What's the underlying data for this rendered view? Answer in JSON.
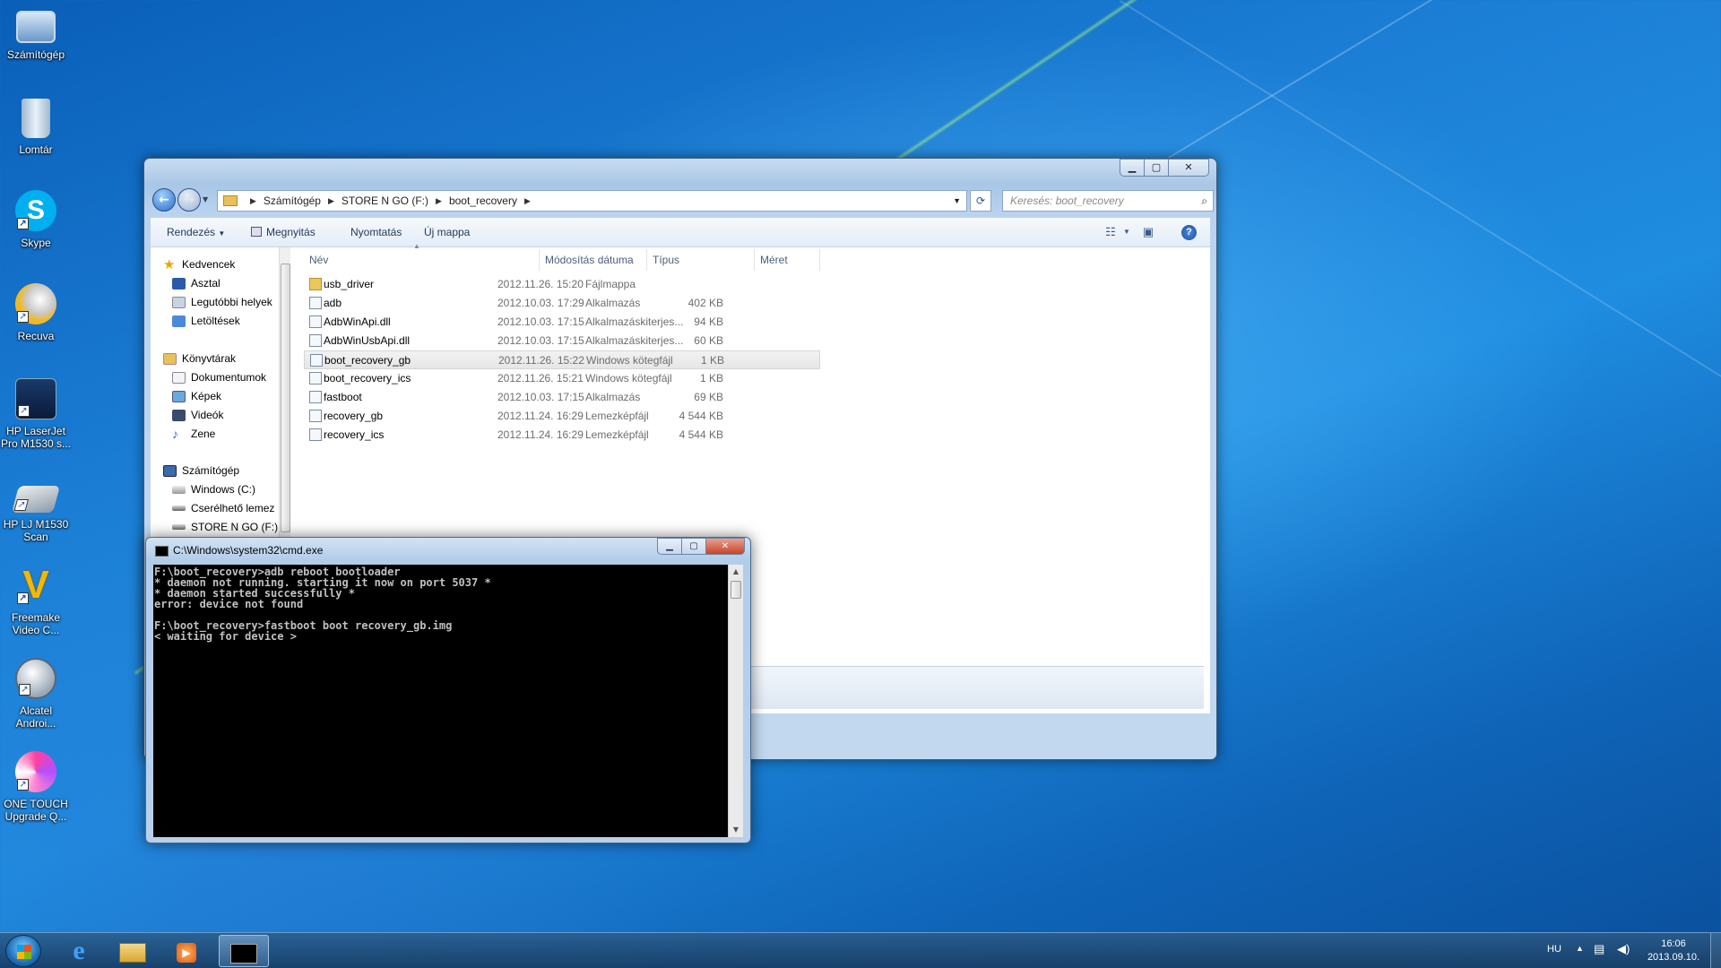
{
  "desktop": {
    "icons": [
      {
        "label": "Számítógép"
      },
      {
        "label": "Lomtár"
      },
      {
        "label": "Skype"
      },
      {
        "label": "Recuva"
      },
      {
        "label": "HP LaserJet Pro M1530 s..."
      },
      {
        "label": "HP LJ M1530 Scan"
      },
      {
        "label": "Freemake Video C..."
      },
      {
        "label": "Alcatel Androi..."
      },
      {
        "label": "ONE TOUCH Upgrade Q..."
      }
    ]
  },
  "explorer": {
    "breadcrumb": [
      "Számítógép",
      "STORE N GO (F:)",
      "boot_recovery"
    ],
    "search_placeholder": "Keresés: boot_recovery",
    "toolbar": {
      "organize": "Rendezés",
      "open": "Megnyitás",
      "print": "Nyomtatás",
      "new_folder": "Új mappa"
    },
    "nav": {
      "favorites": "Kedvencek",
      "desktop": "Asztal",
      "recent": "Legutóbbi helyek",
      "downloads": "Letöltések",
      "libraries": "Könyvtárak",
      "documents": "Dokumentumok",
      "pictures": "Képek",
      "videos": "Videók",
      "music": "Zene",
      "computer": "Számítógép",
      "drive_c": "Windows (C:)",
      "removable": "Cserélhető lemez",
      "drive_f": "STORE N GO (F:)"
    },
    "columns": {
      "name": "Név",
      "date": "Módosítás dátuma",
      "type": "Típus",
      "size": "Méret"
    },
    "files": [
      {
        "name": "usb_driver",
        "date": "2012.11.26. 15:20",
        "type": "Fájlmappa",
        "size": ""
      },
      {
        "name": "adb",
        "date": "2012.10.03. 17:29",
        "type": "Alkalmazás",
        "size": "402 KB"
      },
      {
        "name": "AdbWinApi.dll",
        "date": "2012.10.03. 17:15",
        "type": "Alkalmazáskiterjes...",
        "size": "94 KB"
      },
      {
        "name": "AdbWinUsbApi.dll",
        "date": "2012.10.03. 17:15",
        "type": "Alkalmazáskiterjes...",
        "size": "60 KB"
      },
      {
        "name": "boot_recovery_gb",
        "date": "2012.11.26. 15:22",
        "type": "Windows kötegfájl",
        "size": "1 KB"
      },
      {
        "name": "boot_recovery_ics",
        "date": "2012.11.26. 15:21",
        "type": "Windows kötegfájl",
        "size": "1 KB"
      },
      {
        "name": "fastboot",
        "date": "2012.10.03. 17:15",
        "type": "Alkalmazás",
        "size": "69 KB"
      },
      {
        "name": "recovery_gb",
        "date": "2012.11.24. 16:29",
        "type": "Lemezképfájl",
        "size": "4 544 KB"
      },
      {
        "name": "recovery_ics",
        "date": "2012.11.24. 16:29",
        "type": "Lemezképfájl",
        "size": "4 544 KB"
      }
    ]
  },
  "cmd": {
    "title": "C:\\Windows\\system32\\cmd.exe",
    "output": "F:\\boot_recovery>adb reboot bootloader\n* daemon not running. starting it now on port 5037 *\n* daemon started successfully *\nerror: device not found\n\nF:\\boot_recovery>fastboot boot recovery_gb.img\n< waiting for device >"
  },
  "taskbar": {
    "language": "HU",
    "time": "16:06",
    "date": "2013.09.10."
  },
  "colors": {
    "accent": "#1f8de0",
    "selection": "#e6e6e6"
  }
}
